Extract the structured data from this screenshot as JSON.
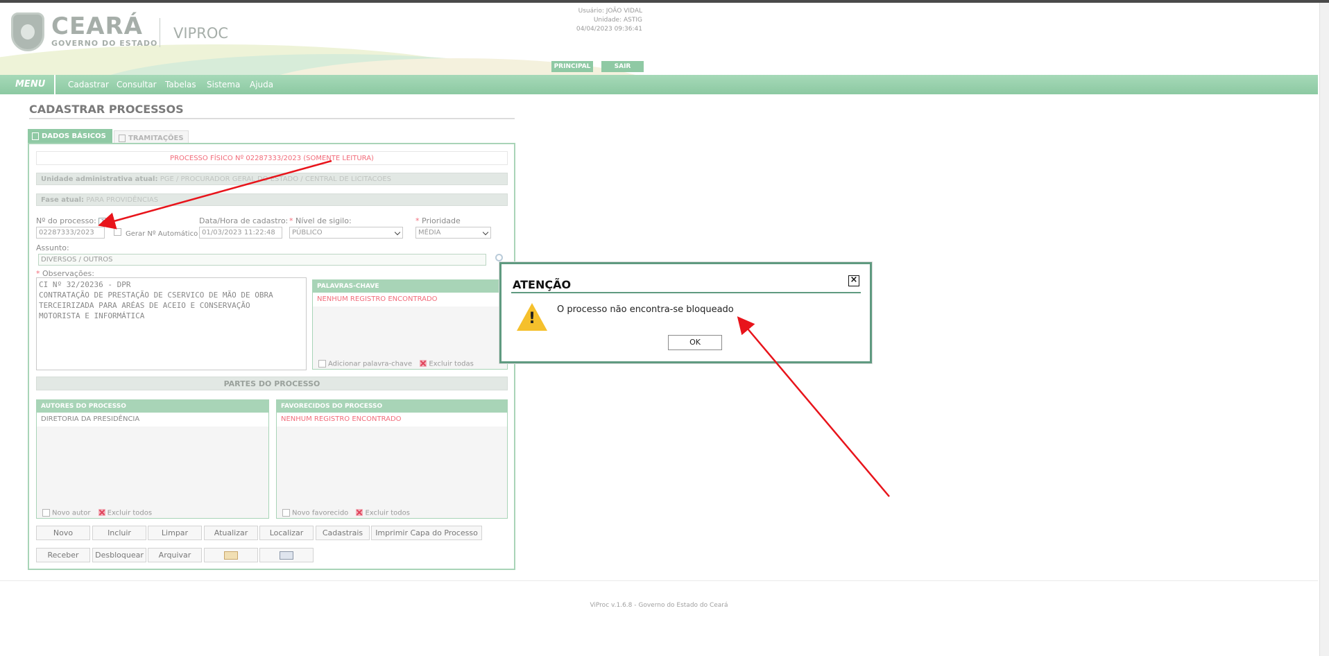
{
  "header": {
    "brand_title": "CEARÁ",
    "brand_subtitle": "GOVERNO DO ESTADO",
    "app_name": "VIPROC",
    "user_line": "Usuário: JOÃO VIDAL",
    "unit_line": "Unidade: ASTIG",
    "datetime": "04/04/2023 09:36:41",
    "btn_principal": "PRINCIPAL",
    "btn_sair": "SAIR"
  },
  "menu": {
    "label": "MENU",
    "items": [
      "Cadastrar",
      "Consultar",
      "Tabelas",
      "Sistema",
      "Ajuda"
    ]
  },
  "page": {
    "title": "CADASTRAR PROCESSOS"
  },
  "tabs": [
    {
      "label": "DADOS BÁSICOS",
      "active": true
    },
    {
      "label": "TRAMITAÇÕES",
      "active": false
    }
  ],
  "form": {
    "readonly_banner": "PROCESSO FÍSICO Nº 02287333/2023 (SOMENTE LEITURA)",
    "unidade_label": "Unidade administrativa atual:",
    "unidade_value": "PGE / PROCURADOR GERAL DO ESTADO / CENTRAL DE LICITACOES",
    "fase_label": "Fase atual:",
    "fase_value": "PARA PROVIDÊNCIAS",
    "num_processo_label": "Nº do processo:",
    "num_processo_value": "02287333/2023",
    "gerar_auto_label": "Gerar Nº Automático",
    "data_hora_label": "Data/Hora de cadastro:",
    "data_hora_value": "01/03/2023 11:22:48",
    "sigilo_label": "Nível de sigilo:",
    "sigilo_value": "PÚBLICO",
    "prioridade_label": "Prioridade",
    "prioridade_value": "MÉDIA",
    "assunto_label": "Assunto:",
    "assunto_value": "DIVERSOS / OUTROS",
    "obs_label": "Observações:",
    "obs_value": "CI Nº 32/20236 - DPR\nCONTRATAÇÃO DE PRESTAÇÃO DE CSERVICO DE MÃO DE OBRA\nTERCEIRIZADA PARA ARÉAS DE ACEIO E CONSERVAÇÃO\nMOTORISTA E INFORMÁTICA"
  },
  "keywords": {
    "header": "PALAVRAS-CHAVE",
    "empty": "NENHUM REGISTRO ENCONTRADO",
    "add_label": "Adicionar palavra-chave",
    "delete_all": "Excluir todas"
  },
  "parties": {
    "section_title": "PARTES DO PROCESSO",
    "authors_header": "AUTORES DO PROCESSO",
    "authors_rows": [
      "DIRETORIA DA PRESIDÊNCIA"
    ],
    "authors_new": "Novo autor",
    "authors_delete": "Excluir todos",
    "fav_header": "FAVORECIDOS DO PROCESSO",
    "fav_empty": "NENHUM REGISTRO ENCONTRADO",
    "fav_new": "Novo favorecido",
    "fav_delete": "Excluir todos"
  },
  "buttons": {
    "row1": [
      "Novo",
      "Incluir",
      "Limpar",
      "Atualizar",
      "Localizar",
      "Cadastrais",
      "Imprimir Capa do Processo"
    ],
    "row2": [
      "Receber",
      "Desbloquear",
      "Arquivar"
    ]
  },
  "footer": {
    "text": "ViProc v.1.6.8 - Governo do Estado do Ceará"
  },
  "dialog": {
    "title": "ATENÇÃO",
    "message": "O processo não encontra-se bloqueado",
    "ok": "OK"
  },
  "colors": {
    "accent_green": "#8fc9a4",
    "alert_red": "#f26c7a",
    "annotation_red": "#e8141b"
  }
}
